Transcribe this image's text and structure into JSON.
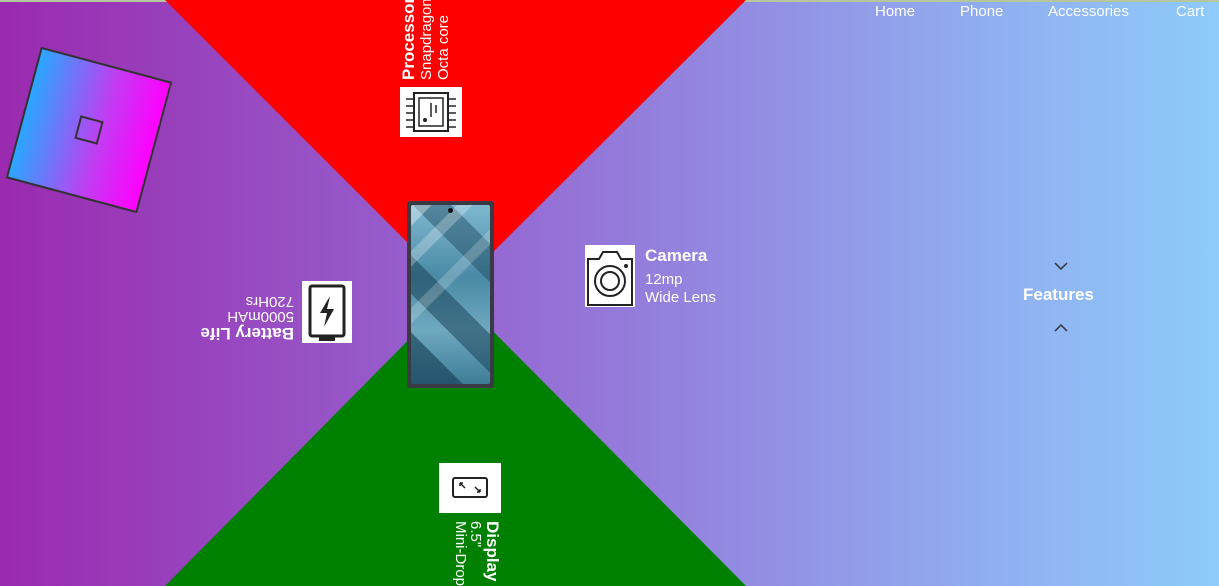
{
  "nav": {
    "home": "Home",
    "phone": "Phone",
    "accessories": "Accessories",
    "cart": "Cart"
  },
  "features": {
    "processor": {
      "title": "Processor",
      "lines": [
        "Snapdragon",
        "Octa core"
      ]
    },
    "camera": {
      "title": "Camera",
      "lines": [
        "12mp",
        "Wide Lens"
      ]
    },
    "battery": {
      "title": "Battery Life",
      "lines": [
        "5000mAH",
        "720Hrs"
      ]
    },
    "display": {
      "title": "Display",
      "lines": [
        "6.5\"",
        "Mini-Drop"
      ]
    }
  },
  "features_label": "Features",
  "colors": {
    "top": "#ff0000",
    "bottom": "#008000",
    "logo_start": "#29a7ff",
    "logo_end": "#ff00ff"
  },
  "icons": {
    "logo": "square-logo-icon",
    "processor": "cpu-chip-icon",
    "camera": "camera-icon",
    "battery": "battery-charging-icon",
    "display": "expand-screen-icon",
    "chev_up": "chevron-down-icon",
    "chev_down": "chevron-up-icon"
  }
}
